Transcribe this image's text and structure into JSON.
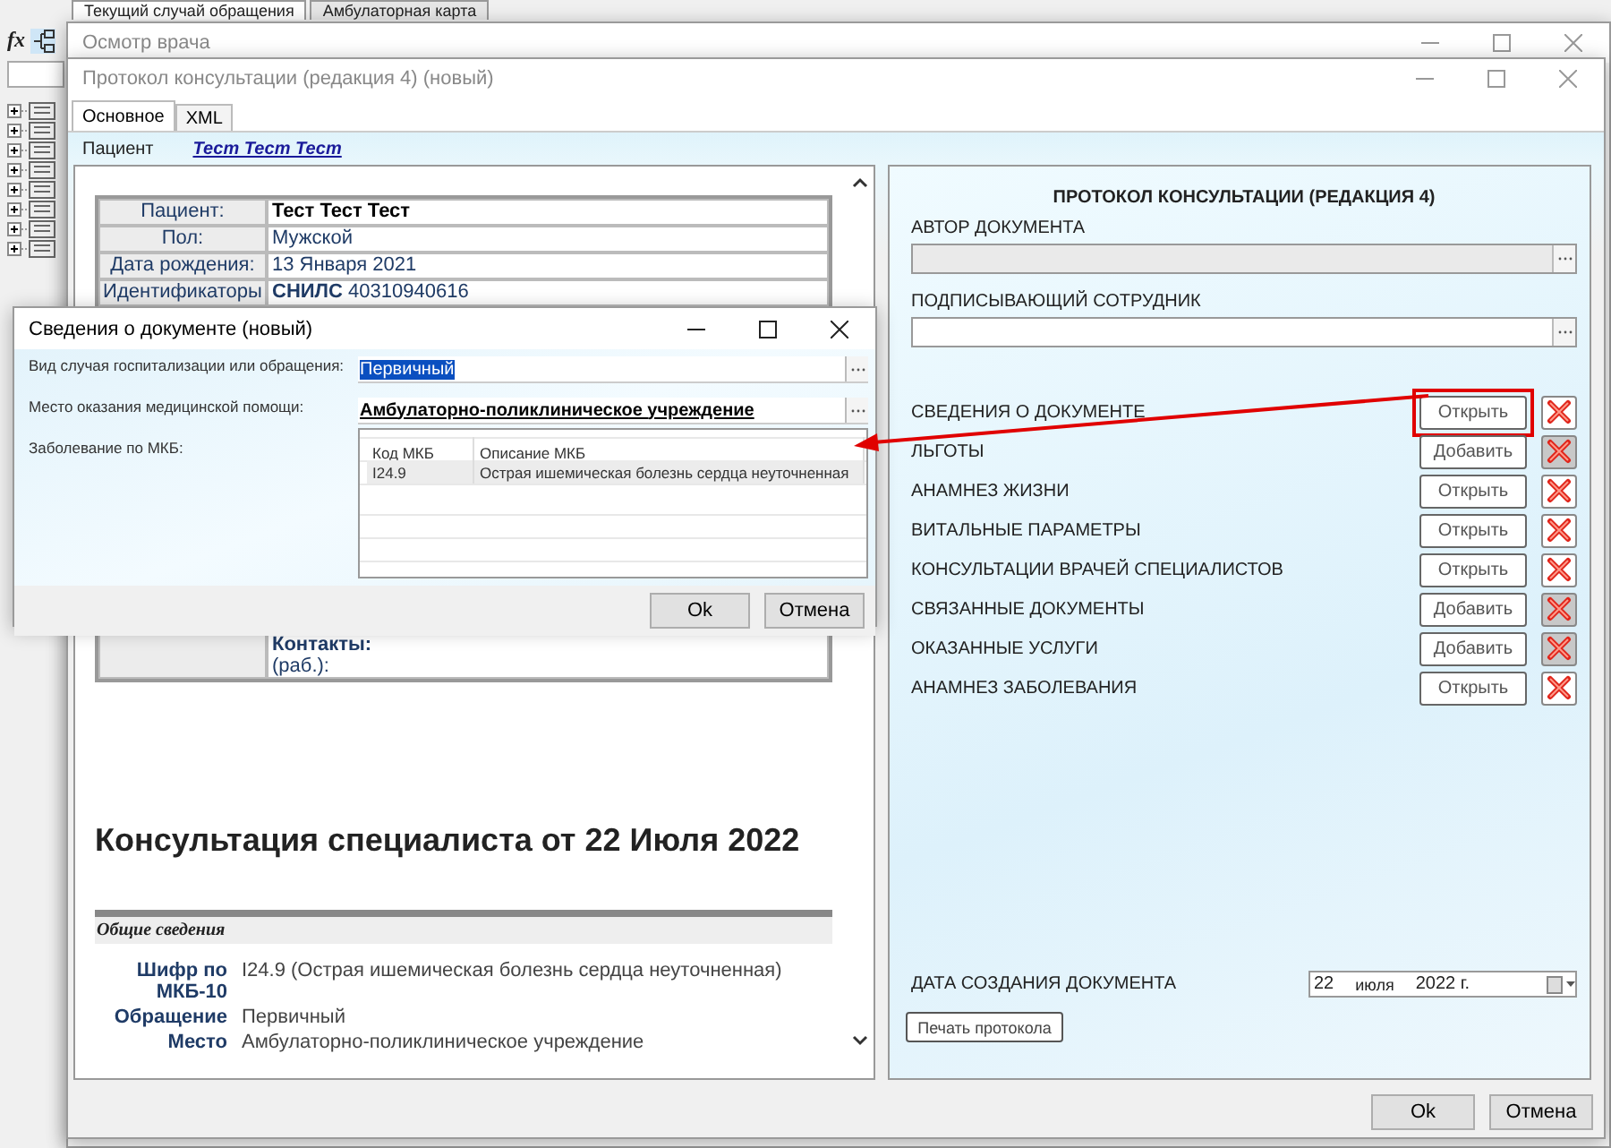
{
  "app": {
    "tabs": [
      {
        "label": "Текущий случай обращения",
        "selected": true
      },
      {
        "label": "Амбулаторная карта",
        "selected": false
      }
    ],
    "formula_label": "fx"
  },
  "main_window": {
    "title": "Осмотр врача"
  },
  "protocol_window": {
    "title": "Протокол консультации (редакция 4) (новый)",
    "tabs": [
      {
        "label": "Основное",
        "selected": true
      },
      {
        "label": "XML",
        "selected": false
      }
    ],
    "patient_label": "Пациент",
    "patient_link": "Тест Тест Тест",
    "document": {
      "patient_table": [
        {
          "label": "Пациент:",
          "value": "Тест Тест Тест",
          "bold": true
        },
        {
          "label": "Пол:",
          "value": "Мужской",
          "bold": false
        },
        {
          "label": "Дата рождения:",
          "value": "13 Января 2021",
          "bold": false
        },
        {
          "label": "Идентификаторы",
          "value": "**СНИЛС** 40310940616",
          "bold": false
        }
      ],
      "contacts": {
        "label": "Контакты:",
        "value": "(раб.):"
      },
      "heading": "Консультация специалиста от 22 Июля 2022",
      "section": "Общие сведения",
      "fields": [
        {
          "label": "Шифр по МКБ-10",
          "value": "I24.9 (Острая ишемическая болезнь сердца неуточненная)"
        },
        {
          "label": "Обращение",
          "value": "Первичный"
        },
        {
          "label": "Место",
          "value": "Амбулаторно-поликлиническое учреждение"
        }
      ]
    },
    "form": {
      "title": "ПРОТОКОЛ КОНСУЛЬТАЦИИ (РЕДАКЦИЯ 4)",
      "author": {
        "label": "АВТОР ДОКУМЕНТА",
        "disabled": true
      },
      "signer": {
        "label": "ПОДПИСЫВАЮЩИЙ СОТРУДНИК",
        "disabled": false
      },
      "sections": [
        {
          "label": "СВЕДЕНИЯ О ДОКУМЕНТЕ",
          "kind": "open",
          "action": "Открыть",
          "highlighted": true
        },
        {
          "label": "ЛЬГОТЫ",
          "kind": "add",
          "action": "Добавить",
          "highlighted": false
        },
        {
          "label": "АНАМНЕЗ ЖИЗНИ",
          "kind": "open",
          "action": "Открыть",
          "highlighted": false
        },
        {
          "label": "ВИТАЛЬНЫЕ ПАРАМЕТРЫ",
          "kind": "open",
          "action": "Открыть",
          "highlighted": false
        },
        {
          "label": "КОНСУЛЬТАЦИИ ВРАЧЕЙ СПЕЦИАЛИСТОВ",
          "kind": "open",
          "action": "Открыть",
          "highlighted": false
        },
        {
          "label": "СВЯЗАННЫЕ ДОКУМЕНТЫ",
          "kind": "add",
          "action": "Добавить",
          "highlighted": false
        },
        {
          "label": "ОКАЗАННЫЕ УСЛУГИ",
          "kind": "add",
          "action": "Добавить",
          "highlighted": false
        },
        {
          "label": "АНАМНЕЗ ЗАБОЛЕВАНИЯ",
          "kind": "open",
          "action": "Открыть",
          "highlighted": false
        }
      ],
      "date": {
        "label": "ДАТА СОЗДАНИЯ ДОКУМЕНТА",
        "day": "22",
        "month": "июля",
        "year": "2022 г."
      },
      "print_button": "Печать протокола"
    },
    "buttons": [
      "Ok",
      "Отмена"
    ]
  },
  "dialog": {
    "title": "Сведения о документе (новый)",
    "fields": [
      {
        "label": "Вид случая госпитализации или обращения:",
        "value": "Первичный",
        "selected": true,
        "bold": false
      },
      {
        "label": "Место оказания медицинской помощи:",
        "value": "Амбулаторно-поликлиническое учреждение",
        "selected": false,
        "bold": true
      }
    ],
    "grid": {
      "label": "Заболевание по МКБ:",
      "columns": [
        "Код МКБ",
        "Описание МКБ"
      ],
      "rows": [
        {
          "cells": [
            "I24.9",
            "Острая ишемическая болезнь сердца неуточненная"
          ],
          "selected": true
        }
      ]
    },
    "buttons": [
      "Ok",
      "Отмена"
    ]
  }
}
